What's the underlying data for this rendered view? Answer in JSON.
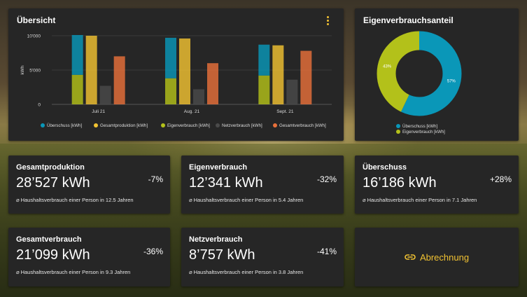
{
  "overview": {
    "title": "Übersicht",
    "menu_icon": "more-vert-icon"
  },
  "chart_data": [
    {
      "type": "bar",
      "title": "",
      "xlabel": "",
      "ylabel": "kWh",
      "ylim": [
        0,
        10000
      ],
      "yticks": [
        "0",
        "5'000",
        "10'000"
      ],
      "categories": [
        "Juli 21",
        "Aug. 21",
        "Sept. 21"
      ],
      "grid": true,
      "legend_position": "bottom",
      "series": [
        {
          "name": "Überschuss [kWh]",
          "color": "#0a97b8",
          "stack": "a",
          "values": [
            5800,
            5900,
            4500
          ]
        },
        {
          "name": "Gesamtproduktion [kWh]",
          "color": "#f1c232",
          "stack": "b",
          "values": [
            10000,
            9600,
            8600
          ]
        },
        {
          "name": "Eigenverbrauch [kWh]",
          "color": "#b3c11a",
          "stack": "a",
          "values": [
            4300,
            3800,
            4200
          ]
        },
        {
          "name": "Netzverbrauch [kWh]",
          "color": "#4a4a4a",
          "stack": "c",
          "values": [
            2700,
            2200,
            3600
          ]
        },
        {
          "name": "Gesamtverbrauch [kWh]",
          "color": "#e8703a",
          "stack": "d",
          "values": [
            7000,
            6000,
            7800
          ]
        }
      ]
    },
    {
      "type": "pie",
      "title": "Eigenverbrauchsanteil",
      "legend_position": "bottom",
      "slices": [
        {
          "name": "Überschuss [kWh]",
          "value": 57,
          "label": "57%",
          "color": "#0a97b8"
        },
        {
          "name": "Eigenverbrauch [kWh]",
          "value": 43,
          "label": "43%",
          "color": "#b3c11a"
        }
      ]
    }
  ],
  "stats": [
    {
      "title": "Gesamtproduktion",
      "value": "28’527 kWh",
      "pct": "-7%",
      "note": "⌀ Haushaltsverbrauch einer Person in 12.5 Jahren"
    },
    {
      "title": "Eigenverbrauch",
      "value": "12’341 kWh",
      "pct": "-32%",
      "note": "⌀ Haushaltsverbrauch einer Person in 5.4 Jahren"
    },
    {
      "title": "Überschuss",
      "value": "16’186 kWh",
      "pct": "+28%",
      "note": "⌀ Haushaltsverbrauch einer Person in 7.1 Jahren"
    },
    {
      "title": "Gesamtverbrauch",
      "value": "21’099 kWh",
      "pct": "-36%",
      "note": "⌀ Haushaltsverbrauch einer Person in 9.3 Jahren"
    },
    {
      "title": "Netzverbrauch",
      "value": "8’757 kWh",
      "pct": "-41%",
      "note": "⌀ Haushaltsverbrauch einer Person in 3.8 Jahren"
    }
  ],
  "billing": {
    "label": "Abrechnung",
    "icon": "link-icon",
    "accent": "#f1c232"
  }
}
